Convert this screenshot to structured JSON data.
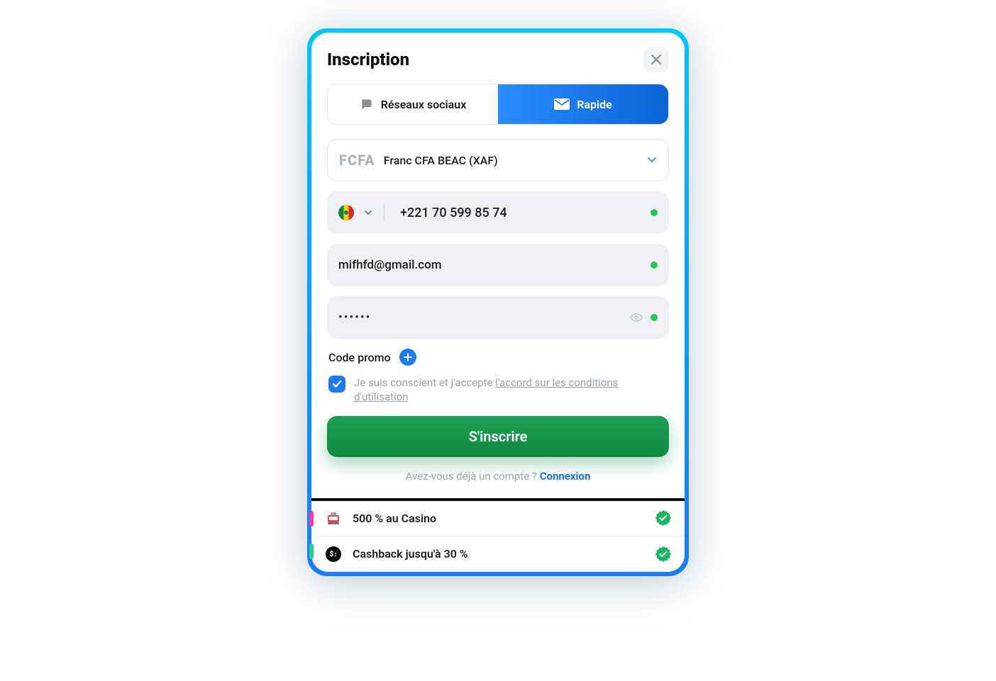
{
  "title": "Inscription",
  "tabs": {
    "social": "Réseaux sociaux",
    "quick": "Rapide"
  },
  "currency": {
    "code": "FCFA",
    "name": "Franc CFA BEAC (XAF)"
  },
  "phone": {
    "value": "+221 70 599 85 74"
  },
  "email": {
    "value": "mifhfd@gmail.com"
  },
  "password": {
    "masked": "••••••"
  },
  "promo": {
    "label": "Code promo"
  },
  "terms": {
    "prefix": "Je suis conscient et j'accepte ",
    "link": "l'accord sur les conditions d'utilisation"
  },
  "signup_label": "S'inscrire",
  "login": {
    "prefix": "Avez-vous déjà un compte ? ",
    "link": "Connexion"
  },
  "strips": {
    "casino": "500 % au Casino",
    "cashback": "Cashback jusqu'à 30 %"
  }
}
